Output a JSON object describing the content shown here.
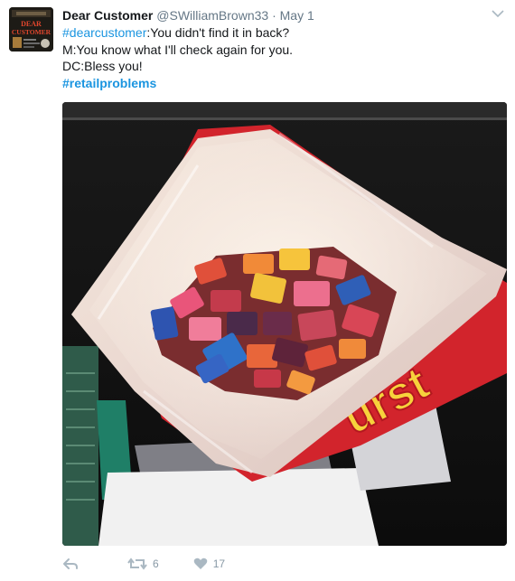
{
  "tweet": {
    "display_name": "Dear Customer",
    "handle": "@SWilliamBrown33",
    "separator": "·",
    "timestamp": "May 1",
    "avatar_text": [
      "DEAR",
      "CUSTOMER"
    ],
    "lines": {
      "line1_hashtag": "#dearcustomer",
      "line1_text": ":You didn't find it in back?",
      "line2": "M:You know what I'll check again for you.",
      "line3": "DC:Bless you!",
      "line4_hashtag": "#retailproblems"
    },
    "media": {
      "bag_brand_text": "urst",
      "icon": "photo-candy-bag"
    },
    "actions": {
      "reply_icon": "reply-icon",
      "retweet_icon": "retweet-icon",
      "retweet_count": "6",
      "like_icon": "heart-icon",
      "like_count": "17"
    }
  },
  "colors": {
    "link": "#1b95e0",
    "muted": "#657786",
    "action": "#8899a6",
    "text": "#14171a"
  }
}
